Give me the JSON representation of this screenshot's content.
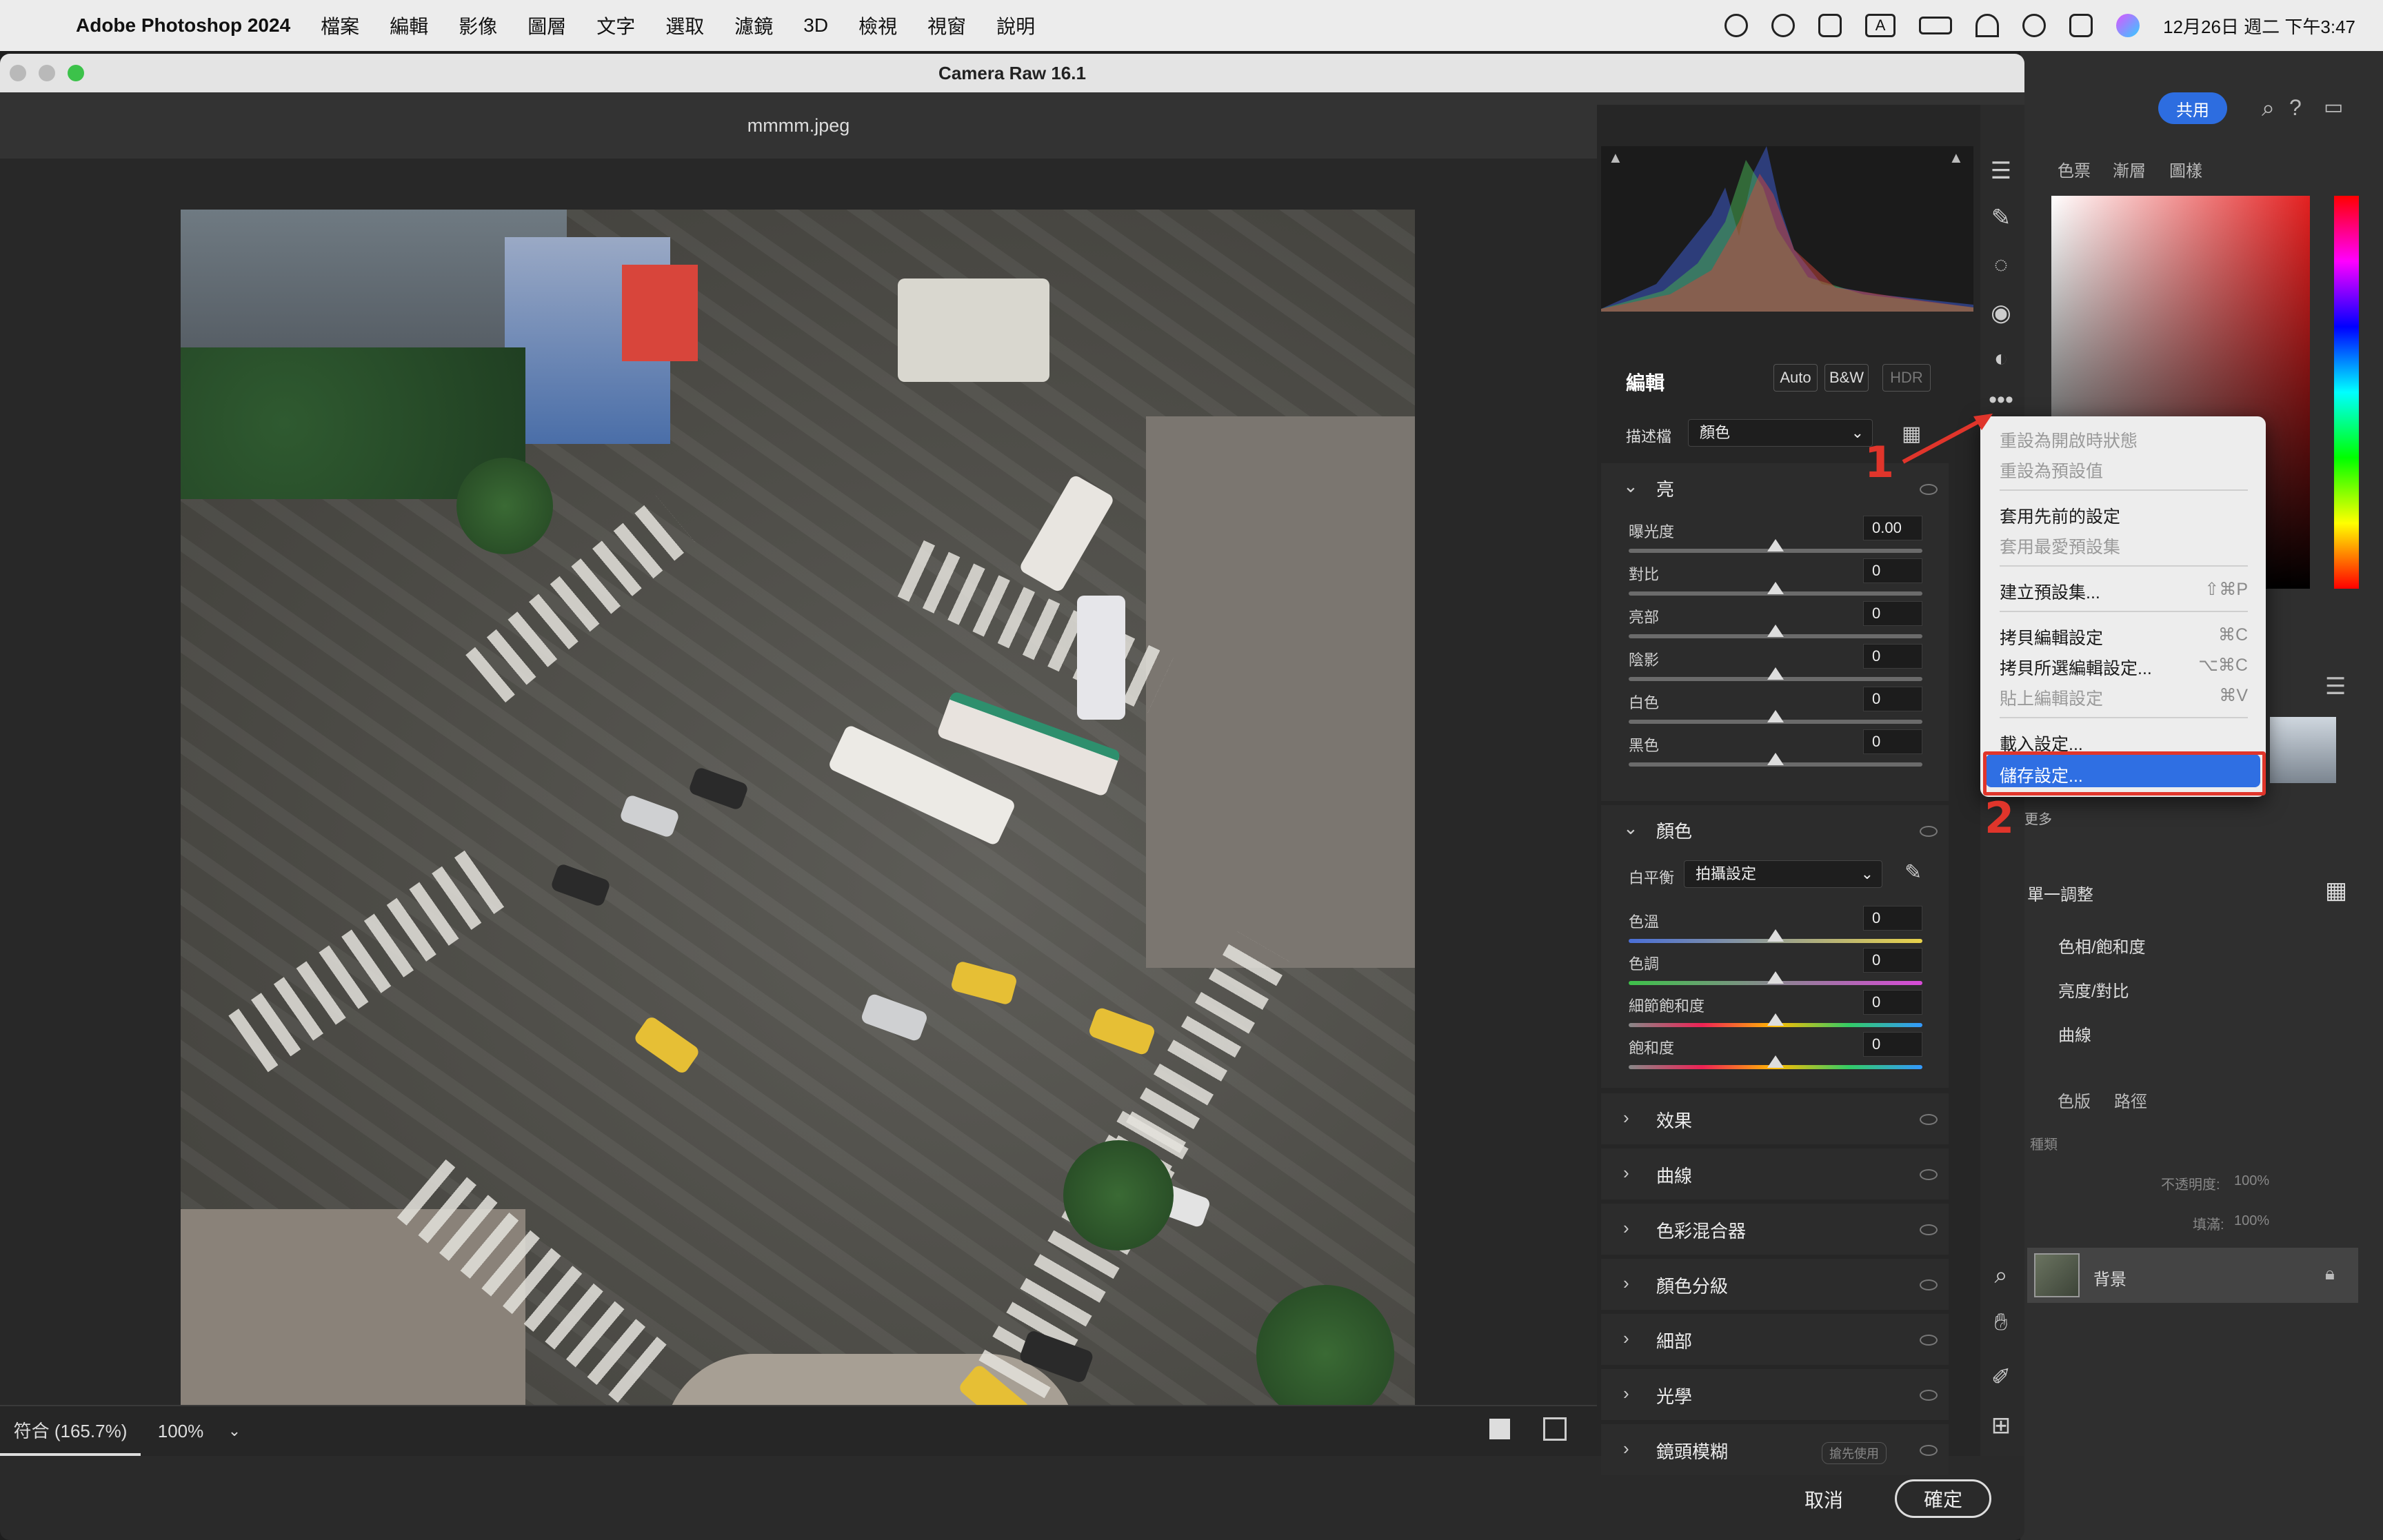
{
  "menubar": {
    "app_name": "Adobe Photoshop 2024",
    "items": [
      "檔案",
      "編輯",
      "影像",
      "圖層",
      "文字",
      "選取",
      "濾鏡",
      "3D",
      "檢視",
      "視窗",
      "說明"
    ],
    "clock": "12月26日 週二 下午3:47",
    "input_method": "A"
  },
  "photoshop": {
    "share_label": "共用",
    "panel_tabs_top": [
      "色票",
      "漸層",
      "圖樣"
    ],
    "more_label": "更多",
    "adjust_title": "單一調整",
    "adjust_items": [
      "色相/飽和度",
      "亮度/對比",
      "曲線"
    ],
    "layer_tabs": [
      "色版",
      "路徑"
    ],
    "layer_kind": "種類",
    "opacity_label": "不透明度:",
    "opacity_value": "100%",
    "fill_label": "填滿:",
    "fill_value": "100%",
    "layer_name": "背景"
  },
  "camera_raw": {
    "window_title": "Camera Raw 16.1",
    "filename": "mmmm.jpeg",
    "zoom_fit": "符合 (165.7%)",
    "zoom_100": "100%",
    "edit_title": "編輯",
    "auto_label": "Auto",
    "bw_label": "B&W",
    "hdr_label": "HDR",
    "profile_label": "描述檔",
    "profile_value": "顏色",
    "light": {
      "title": "亮",
      "sliders": [
        {
          "label": "曝光度",
          "value": "0.00"
        },
        {
          "label": "對比",
          "value": "0"
        },
        {
          "label": "亮部",
          "value": "0"
        },
        {
          "label": "陰影",
          "value": "0"
        },
        {
          "label": "白色",
          "value": "0"
        },
        {
          "label": "黑色",
          "value": "0"
        }
      ]
    },
    "color": {
      "title": "顏色",
      "wb_label": "白平衡",
      "wb_value": "拍攝設定",
      "sliders": [
        {
          "label": "色溫",
          "value": "0"
        },
        {
          "label": "色調",
          "value": "0"
        },
        {
          "label": "細節飽和度",
          "value": "0"
        },
        {
          "label": "飽和度",
          "value": "0"
        }
      ]
    },
    "collapsed_sections": [
      "效果",
      "曲線",
      "色彩混合器",
      "顏色分級",
      "細部",
      "光學",
      "鏡頭模糊"
    ],
    "lens_blur_badge": "搶先使用",
    "cancel_label": "取消",
    "ok_label": "確定"
  },
  "context_menu": {
    "items": [
      {
        "label": "重設為開啟時狀態",
        "shortcut": "",
        "disabled": true
      },
      {
        "label": "重設為預設值",
        "shortcut": "",
        "disabled": true
      },
      {
        "label": "套用先前的設定",
        "shortcut": "",
        "disabled": false
      },
      {
        "label": "套用最愛預設集",
        "shortcut": "",
        "disabled": true
      },
      {
        "label": "建立預設集...",
        "shortcut": "⇧⌘P",
        "disabled": false
      },
      {
        "label": "拷貝編輯設定",
        "shortcut": "⌘C",
        "disabled": false
      },
      {
        "label": "拷貝所選編輯設定...",
        "shortcut": "⌥⌘C",
        "disabled": false
      },
      {
        "label": "貼上編輯設定",
        "shortcut": "⌘V",
        "disabled": true
      },
      {
        "label": "載入設定...",
        "shortcut": "",
        "disabled": false
      },
      {
        "label": "儲存設定...",
        "shortcut": "",
        "disabled": false,
        "highlighted": true
      }
    ]
  },
  "annotations": {
    "step1": "1",
    "step2": "2",
    "color": "#e0352b"
  },
  "colors": {
    "accent": "#2f6fe3",
    "annotation": "#e0352b"
  }
}
